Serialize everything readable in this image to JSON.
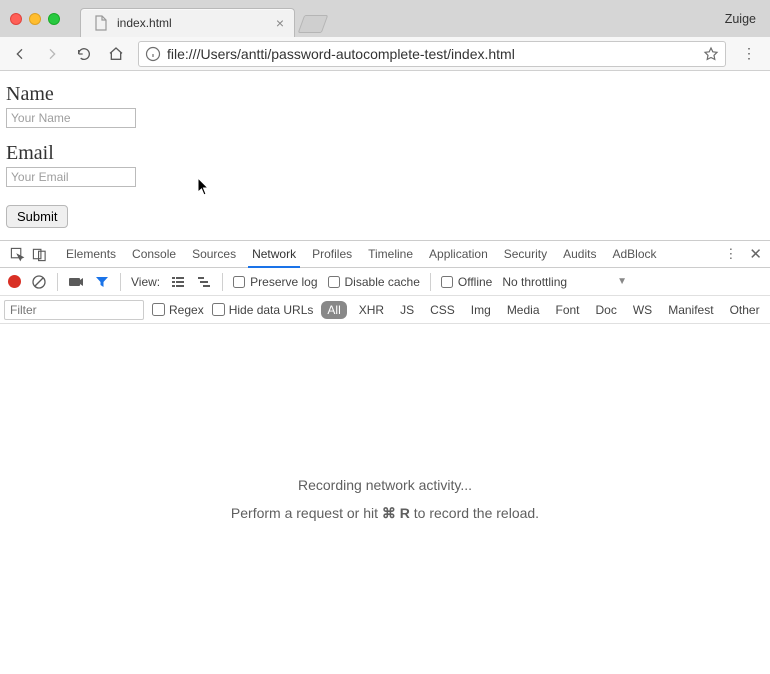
{
  "window": {
    "profile_name": "Zuige",
    "tab_title": "index.html",
    "url": "file:///Users/antti/password-autocomplete-test/index.html"
  },
  "form": {
    "name_label": "Name",
    "name_placeholder": "Your Name",
    "email_label": "Email",
    "email_placeholder": "Your Email",
    "submit_label": "Submit"
  },
  "devtools": {
    "tabs": [
      "Elements",
      "Console",
      "Sources",
      "Network",
      "Profiles",
      "Timeline",
      "Application",
      "Security",
      "Audits",
      "AdBlock"
    ],
    "active_tab": "Network",
    "network": {
      "view_label": "View:",
      "preserve_log": "Preserve log",
      "disable_cache": "Disable cache",
      "offline": "Offline",
      "throttling": "No throttling",
      "filter_placeholder": "Filter",
      "regex": "Regex",
      "hide_data_urls": "Hide data URLs",
      "filters": [
        "All",
        "XHR",
        "JS",
        "CSS",
        "Img",
        "Media",
        "Font",
        "Doc",
        "WS",
        "Manifest",
        "Other"
      ],
      "active_filter": "All",
      "empty_state_line1": "Recording network activity...",
      "empty_state_prefix": "Perform a request or hit ",
      "empty_state_key": "⌘ R",
      "empty_state_suffix": " to record the reload."
    }
  }
}
